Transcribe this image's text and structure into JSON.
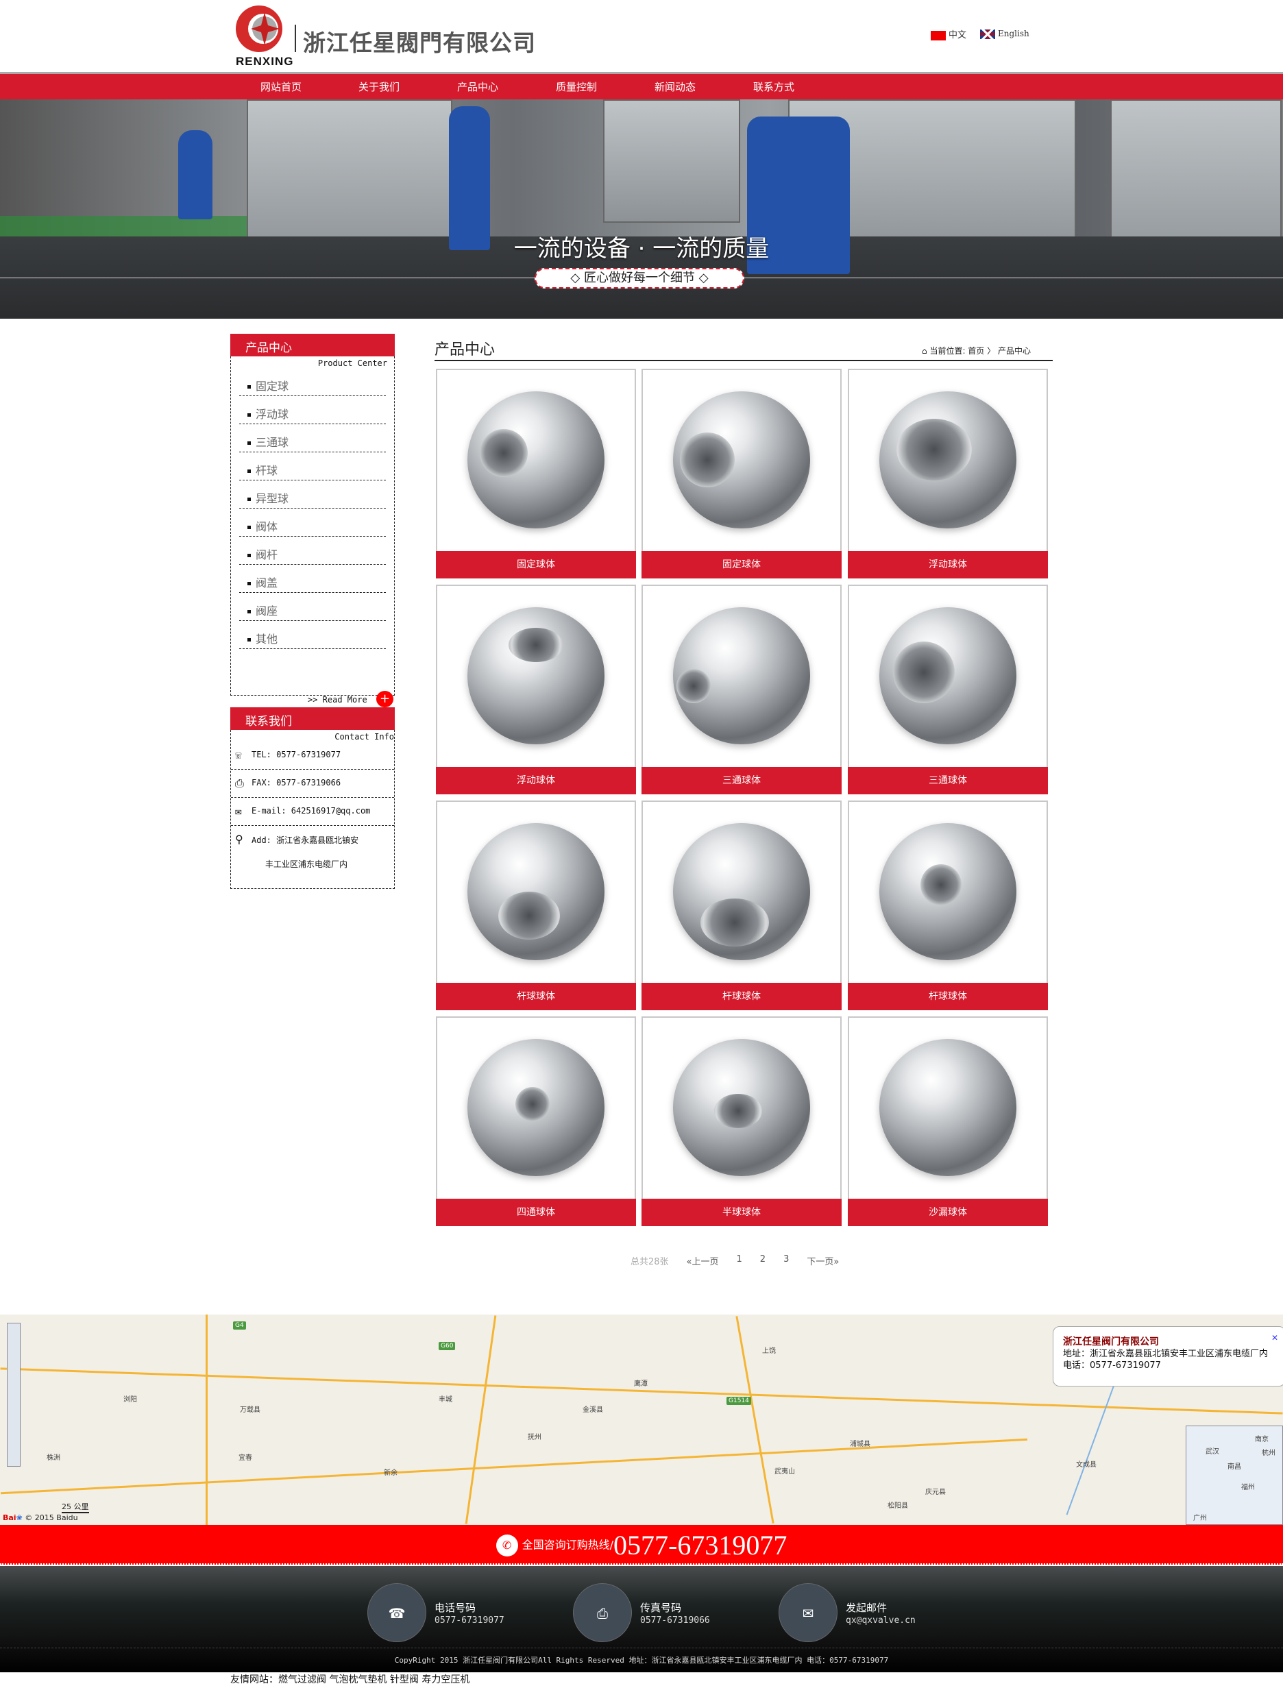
{
  "header": {
    "logo_text": "RENXING",
    "company_name": "浙江任星閥門有限公司",
    "lang": [
      {
        "label": "中文",
        "flag": "cn-flag-icon"
      },
      {
        "label": "English",
        "flag": "uk-flag-icon"
      }
    ]
  },
  "nav": [
    "网站首页",
    "关于我们",
    "产品中心",
    "质量控制",
    "新闻动态",
    "联系方式"
  ],
  "banner": {
    "title": "一流的设备 · 一流的质量",
    "subtitle": "◇ 匠心做好每一个细节 ◇"
  },
  "sidebar": {
    "products": {
      "title": "产品中心",
      "subtitle": "Product Center",
      "items": [
        "固定球",
        "浮动球",
        "三通球",
        "杆球",
        "异型球",
        "阀体",
        "阀杆",
        "阀盖",
        "阀座",
        "其他"
      ],
      "read_more": ">> Read More",
      "plus": "+"
    },
    "contact": {
      "title": "联系我们",
      "subtitle": "Contact Info",
      "tel": "TEL: 0577-67319077",
      "fax": "FAX: 0577-67319066",
      "email": "E-mail: 642516917@qq.com",
      "add1": "Add: 浙江省永嘉县瓯北镇安",
      "add2": "丰工业区浦东电缆厂内"
    }
  },
  "main": {
    "title": "产品中心",
    "breadcrumb": {
      "prefix": "当前位置: ",
      "home": "首页",
      "sep": " 〉 ",
      "current": "产品中心"
    },
    "products": [
      "固定球体",
      "固定球体",
      "浮动球体",
      "浮动球体",
      "三通球体",
      "三通球体",
      "杆球球体",
      "杆球球体",
      "杆球球体",
      "四通球体",
      "半球球体",
      "沙漏球体"
    ],
    "pagination": {
      "total": "总共28张",
      "prev": "«上一页",
      "pages": [
        "1",
        "2",
        "3"
      ],
      "next": "下一页»"
    }
  },
  "map": {
    "info_title": "浙江任星阀门有限公司",
    "info_address": "地址：浙江省永嘉县瓯北镇安丰工业区浦东电缆厂内",
    "info_phone": "电话：0577-67319077",
    "scale": "25 公里",
    "copyright": "© 2015 Baidu",
    "towns": [
      "株洲",
      "宜春",
      "新余",
      "抚州",
      "鹰潭",
      "上饶",
      "浏阳",
      "万载县",
      "丰城",
      "金溪县",
      "武夷山",
      "浦城县",
      "庆元县",
      "松阳县",
      "文成县",
      "武汉",
      "南京",
      "杭州",
      "福州",
      "广州",
      "南昌"
    ]
  },
  "hotline": {
    "label": "全国咨询订购热线/",
    "number": "0577-67319077"
  },
  "footer": {
    "items": [
      {
        "title": "电话号码",
        "value": "0577-67319077"
      },
      {
        "title": "传真号码",
        "value": "0577-67319066"
      },
      {
        "title": "发起邮件",
        "value": "qx@qxvalve.cn"
      }
    ],
    "copyright": "CopyRight 2015 浙江任星阀门有限公司All Rights Reserved 地址：浙江省永嘉县瓯北镇安丰工业区浦东电缆厂内 电话：0577-67319077",
    "friends": "友情网站：燃气过滤阀 气泡枕气垫机 针型阀 寿力空压机"
  },
  "colors": {
    "brand_red": "#d41a2c",
    "hotline_red": "#ff0000"
  }
}
